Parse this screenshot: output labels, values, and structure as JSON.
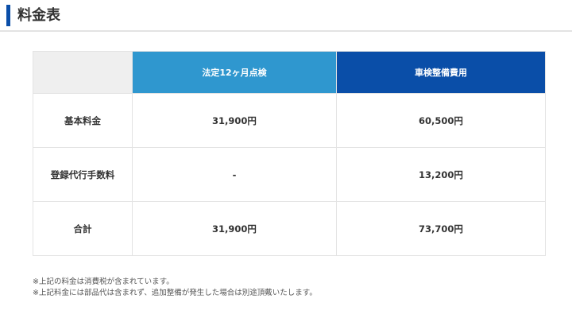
{
  "header": {
    "title": "料金表"
  },
  "table": {
    "columns": [
      "法定12ヶ月点検",
      "車検整備費用"
    ],
    "rows": [
      {
        "label": "基本料金",
        "values": [
          "31,900円",
          "60,500円"
        ]
      },
      {
        "label": "登録代行手数料",
        "values": [
          "-",
          "13,200円"
        ]
      },
      {
        "label": "合計",
        "values": [
          "31,900円",
          "73,700円"
        ]
      }
    ]
  },
  "notes": [
    "※上記の料金は消費税が含まれています。",
    "※上記料金には部品代は含まれず、追加整備が発生した場合は別途頂戴いたします。"
  ],
  "colors": {
    "accent": "#0a4ea8",
    "column_a": "#2f97cf",
    "column_b": "#0a4ea8",
    "corner": "#efefef"
  }
}
